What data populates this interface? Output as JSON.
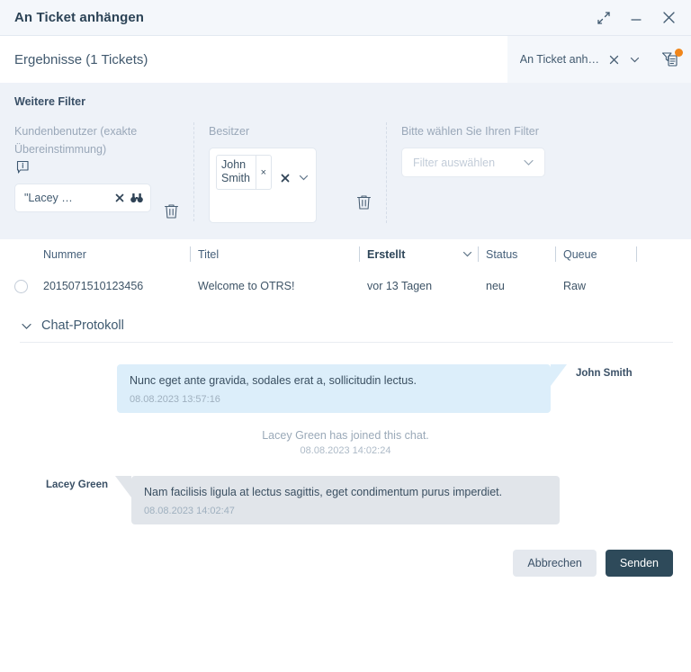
{
  "window": {
    "title": "An Ticket anhängen",
    "controls": [
      {
        "name": "expand-icon",
        "label": "Maximieren"
      },
      {
        "name": "minimize-icon",
        "label": "Minimieren"
      },
      {
        "name": "close-icon",
        "label": "Schließen"
      }
    ]
  },
  "results": {
    "title": "Ergebnisse (1 Tickets)",
    "filter_pill": {
      "label": "An Ticket anh…",
      "clear_icon": "close-icon",
      "expand_icon": "chevron-down-icon"
    },
    "filter_doc_icon": "filter-document-icon",
    "badge_color": "#f0861b"
  },
  "filters": {
    "heading": "Weitere Filter",
    "customer_user": {
      "label": "Kundenbenutzer (exakte Übereinstimmung)",
      "info_icon": "info-tooltip-icon",
      "value": "\"Lacey …",
      "clear_icon": "close-icon",
      "search_icon": "binoculars-icon",
      "delete_icon": "trash-icon"
    },
    "owner": {
      "label": "Besitzer",
      "tags": [
        "John Smith"
      ],
      "tag_remove_icon": "close-icon",
      "clear_icon": "close-icon",
      "expand_icon": "chevron-down-icon",
      "delete_icon": "trash-icon"
    },
    "choose_filter": {
      "label": "Bitte wählen Sie Ihren Filter",
      "placeholder": "Filter auswählen",
      "expand_icon": "chevron-down-icon"
    }
  },
  "table": {
    "columns": [
      {
        "key": "number",
        "label": "Nummer",
        "sorted": false
      },
      {
        "key": "title",
        "label": "Titel",
        "sorted": false
      },
      {
        "key": "created",
        "label": "Erstellt",
        "sorted": true
      },
      {
        "key": "state",
        "label": "Status",
        "sorted": false
      },
      {
        "key": "queue",
        "label": "Queue",
        "sorted": false
      }
    ],
    "sort_icon": "chevron-down-icon",
    "rows": [
      {
        "selected": false,
        "number": "2015071510123456",
        "title": "Welcome to OTRS!",
        "created": "vor 13 Tagen",
        "state": "neu",
        "queue": "Raw"
      }
    ]
  },
  "chat": {
    "section_title": "Chat-Protokoll",
    "collapse_icon": "chevron-down-icon",
    "messages": [
      {
        "type": "agent",
        "author": "John Smith",
        "text": "Nunc eget ante gravida, sodales erat a, sollicitudin lectus.",
        "time": "08.08.2023 13:57:16"
      },
      {
        "type": "system",
        "text": "Lacey Green has joined this chat.",
        "time": "08.08.2023 14:02:24"
      },
      {
        "type": "customer",
        "author": "Lacey Green",
        "text": "Nam facilisis ligula at lectus sagittis, eget condimentum purus imperdiet.",
        "time": "08.08.2023 14:02:47"
      }
    ]
  },
  "footer": {
    "cancel_label": "Abbrechen",
    "submit_label": "Senden"
  }
}
